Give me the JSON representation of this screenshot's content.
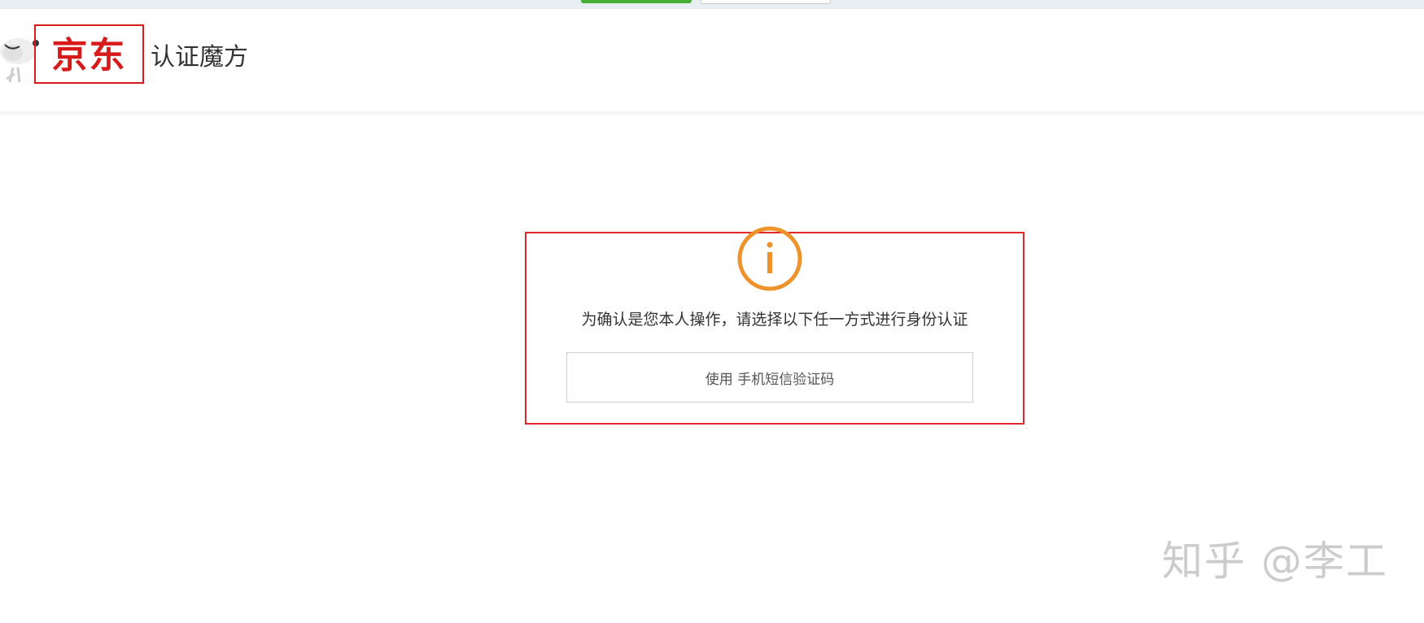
{
  "header": {
    "logo_text": "京东",
    "title": "认证魔方"
  },
  "card": {
    "message": "为确认是您本人操作，请选择以下任一方式进行身份认证",
    "sms_button_label": "使用 手机短信验证码"
  },
  "watermark": {
    "text": "知乎 @李工"
  },
  "icons": {
    "info": "info-icon",
    "mascot": "jd-dog-mascot-icon"
  },
  "colors": {
    "brand_red": "#d71a1a",
    "highlight_border": "#e0272b",
    "info_orange": "#f0922b",
    "top_button_green": "#45b034"
  }
}
